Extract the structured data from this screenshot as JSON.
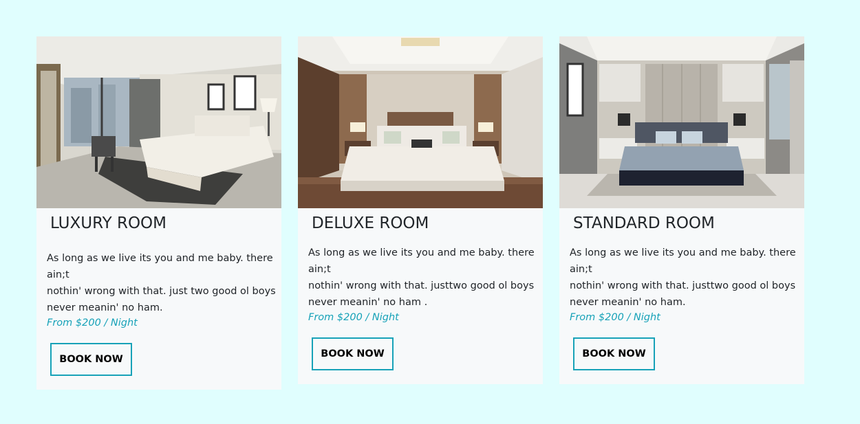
{
  "rooms": [
    {
      "title": "LUXURY ROOM",
      "description": [
        "As long as we live its you and me baby. there",
        "ain;t",
        "nothin' wrong with that. just two good ol boys",
        "never meanin' no ham."
      ],
      "price": "From $200 / Night",
      "button_label": "BOOK NOW"
    },
    {
      "title": "DELUXE ROOM",
      "description": [
        "As long as we live its you and me baby. there",
        "ain;t",
        "nothin' wrong with that. justtwo good ol boys",
        "never meanin' no ham ."
      ],
      "price": "From $200 / Night",
      "button_label": "BOOK NOW"
    },
    {
      "title": "STANDARD ROOM",
      "description": [
        "As long as we live its you and me baby. there",
        "ain;t",
        "nothin' wrong with that. justtwo good ol boys",
        "never meanin' no ham."
      ],
      "price": "From $200 / Night",
      "button_label": "BOOK NOW"
    }
  ],
  "colors": {
    "page_background": "#e0fefe",
    "card_background": "#f7f9fa",
    "accent": "#17a2b8",
    "text": "#212529"
  }
}
